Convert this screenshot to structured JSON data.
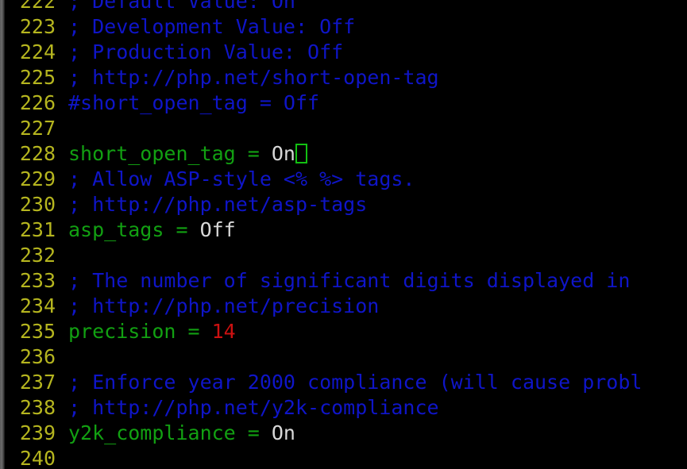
{
  "editor": {
    "kind": "terminal-text-editor",
    "file_kind": "php.ini",
    "background_color": "#000000",
    "linenumber_color": "#b5b51f",
    "comment_color": "#0f15c8",
    "directive_color": "#12a012",
    "value_color": "#d8d8d8",
    "number_color": "#cc1111",
    "cursor_color": "#12c012",
    "cursor": {
      "line_number": "228",
      "after_text": "On",
      "shape": "hollow-block"
    },
    "lines": [
      {
        "number": "222",
        "clipped_top": true,
        "segments": [
          {
            "text": "; Default Value: On",
            "type": "comment"
          }
        ]
      },
      {
        "number": "223",
        "segments": [
          {
            "text": "; Development Value: Off",
            "type": "comment"
          }
        ]
      },
      {
        "number": "224",
        "segments": [
          {
            "text": "; Production Value: Off",
            "type": "comment"
          }
        ]
      },
      {
        "number": "225",
        "segments": [
          {
            "text": "; http://php.net/short-open-tag",
            "type": "comment"
          }
        ]
      },
      {
        "number": "226",
        "segments": [
          {
            "text": "#short_open_tag = Off",
            "type": "comment"
          }
        ]
      },
      {
        "number": "227",
        "segments": []
      },
      {
        "number": "228",
        "has_cursor": true,
        "segments": [
          {
            "text": "short_open_tag = ",
            "type": "directive"
          },
          {
            "text": "On",
            "type": "value"
          }
        ]
      },
      {
        "number": "229",
        "segments": [
          {
            "text": "; Allow ASP-style <% %> tags.",
            "type": "comment"
          }
        ]
      },
      {
        "number": "230",
        "segments": [
          {
            "text": "; http://php.net/asp-tags",
            "type": "comment"
          }
        ]
      },
      {
        "number": "231",
        "segments": [
          {
            "text": "asp_tags = ",
            "type": "directive"
          },
          {
            "text": "Off",
            "type": "value"
          }
        ]
      },
      {
        "number": "232",
        "segments": []
      },
      {
        "number": "233",
        "truncated_right": true,
        "segments": [
          {
            "text": "; The number of significant digits displayed in",
            "type": "comment"
          }
        ]
      },
      {
        "number": "234",
        "segments": [
          {
            "text": "; http://php.net/precision",
            "type": "comment"
          }
        ]
      },
      {
        "number": "235",
        "segments": [
          {
            "text": "precision = ",
            "type": "directive"
          },
          {
            "text": "14",
            "type": "number"
          }
        ]
      },
      {
        "number": "236",
        "segments": []
      },
      {
        "number": "237",
        "truncated_right": true,
        "segments": [
          {
            "text": "; Enforce year 2000 compliance (will cause probl",
            "type": "comment"
          }
        ]
      },
      {
        "number": "238",
        "segments": [
          {
            "text": "; http://php.net/y2k-compliance",
            "type": "comment"
          }
        ]
      },
      {
        "number": "239",
        "segments": [
          {
            "text": "y2k_compliance = ",
            "type": "directive"
          },
          {
            "text": "On",
            "type": "value"
          }
        ]
      },
      {
        "number": "240",
        "clipped_bottom": true,
        "segments": []
      }
    ]
  }
}
